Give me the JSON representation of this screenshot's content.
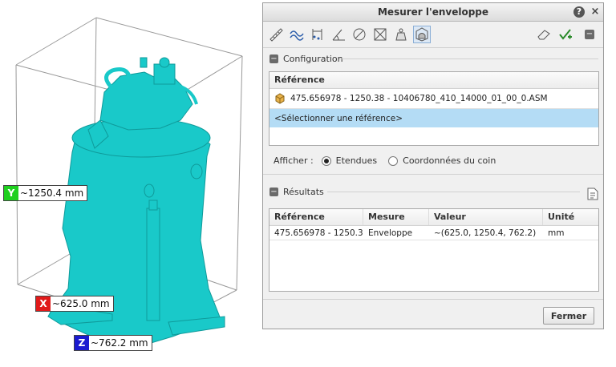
{
  "viewport": {
    "dimensions": [
      {
        "axis": "Y",
        "value": "~1250.4 mm",
        "color": "#1ed01e"
      },
      {
        "axis": "X",
        "value": "~625.0 mm",
        "color": "#e01a1a"
      },
      {
        "axis": "Z",
        "value": "~762.2 mm",
        "color": "#1a1ad0"
      }
    ],
    "model_color": "#19c9c9"
  },
  "dialog": {
    "title": "Mesurer l'enveloppe",
    "help_glyph": "?",
    "close_glyph": "×",
    "toolbar_tools": [
      "ruler-icon",
      "curve-length-icon",
      "distance-icon",
      "angle-icon",
      "diameter-icon",
      "area-icon",
      "volume-icon",
      "bounding-box-icon"
    ],
    "toolbar_right": [
      "eraser-icon",
      "save-measure-icon",
      "collapse-icon"
    ],
    "configuration": {
      "label": "Configuration",
      "header": "Référence",
      "rows": [
        {
          "text": "475.656978 - 1250.38 -    10406780_410_14000_01_00_0.ASM",
          "icon": "part-cube-icon"
        },
        {
          "text": "<Sélectionner une référence>",
          "selected": true
        }
      ],
      "display_label": "Afficher :",
      "options": [
        "Etendues",
        "Coordonnées du coin"
      ],
      "selected_option": "Etendues"
    },
    "results": {
      "label": "Résultats",
      "columns": [
        "Référence",
        "Mesure",
        "Valeur",
        "Unité"
      ],
      "rows": [
        [
          "475.656978 - 1250.3...",
          "Enveloppe",
          "~(625.0, 1250.4, 762.2)",
          "mm"
        ]
      ]
    },
    "close_button": "Fermer",
    "accent": "#b4dcf5"
  }
}
